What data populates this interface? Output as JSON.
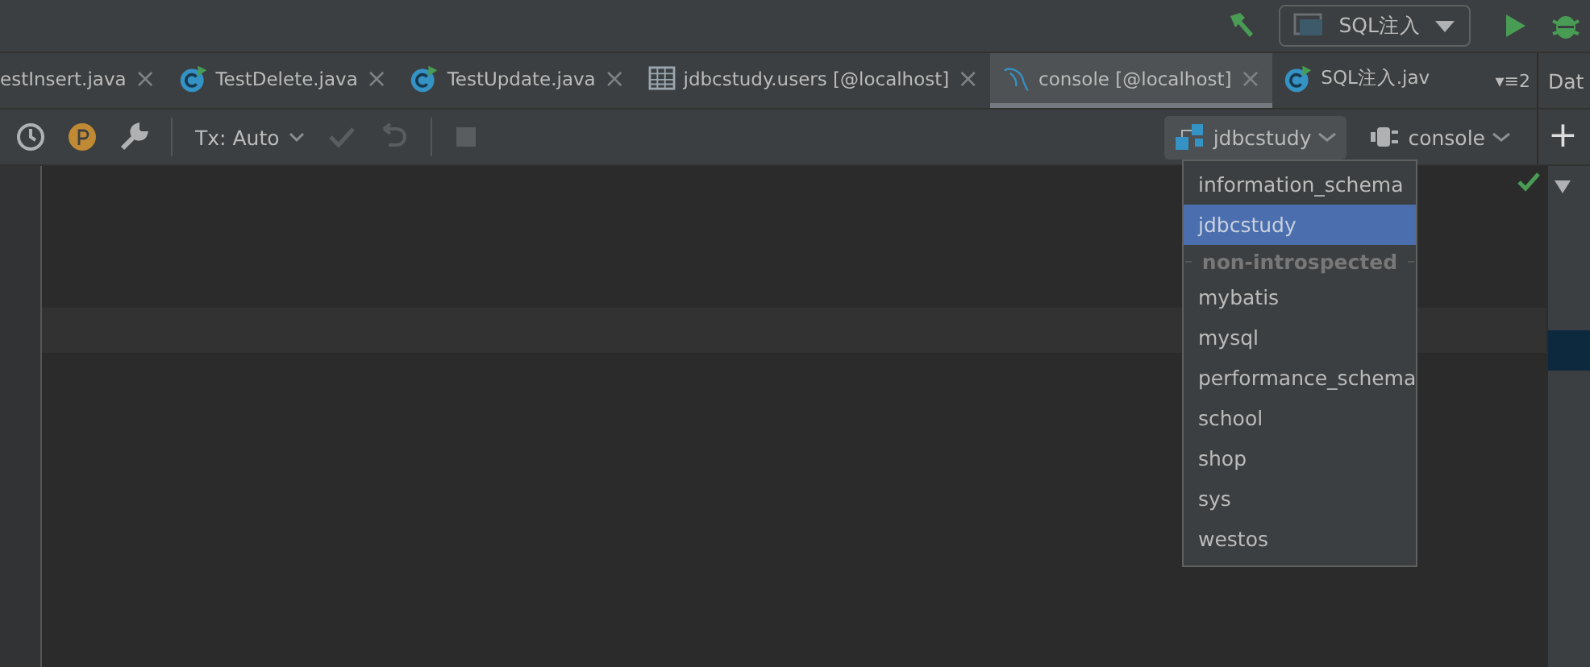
{
  "top_bar": {
    "run_config": "SQL注入"
  },
  "tabs": [
    {
      "label": "estInsert.java",
      "kind": "plain",
      "selected": false,
      "close": "×"
    },
    {
      "label": "TestDelete.java",
      "kind": "class",
      "selected": false,
      "close": "×"
    },
    {
      "label": "TestUpdate.java",
      "kind": "class",
      "selected": false,
      "close": "×"
    },
    {
      "label": "jdbcstudy.users [@localhost]",
      "kind": "table",
      "selected": false,
      "close": "×"
    },
    {
      "label": "console [@localhost]",
      "kind": "console",
      "selected": true,
      "close": "×"
    },
    {
      "label": "SQL注入.jav",
      "kind": "class",
      "selected": false
    }
  ],
  "tab_overflow": "▾≡2",
  "side_panel": {
    "title": "Dat",
    "add": "+"
  },
  "toolbar": {
    "tx_mode": "Tx: Auto",
    "schema": "jdbcstudy",
    "session": "console"
  },
  "schema_menu": [
    {
      "kind": "item",
      "label": "information_schema",
      "selected": false
    },
    {
      "kind": "item",
      "label": "jdbcstudy",
      "selected": true
    },
    {
      "kind": "separator",
      "label": "non-introspected"
    },
    {
      "kind": "item",
      "label": "mybatis",
      "selected": false
    },
    {
      "kind": "item",
      "label": "mysql",
      "selected": false
    },
    {
      "kind": "item",
      "label": "performance_schema",
      "selected": false
    },
    {
      "kind": "item",
      "label": "school",
      "selected": false
    },
    {
      "kind": "item",
      "label": "shop",
      "selected": false
    },
    {
      "kind": "item",
      "label": "sys",
      "selected": false
    },
    {
      "kind": "item",
      "label": "westos",
      "selected": false
    }
  ]
}
